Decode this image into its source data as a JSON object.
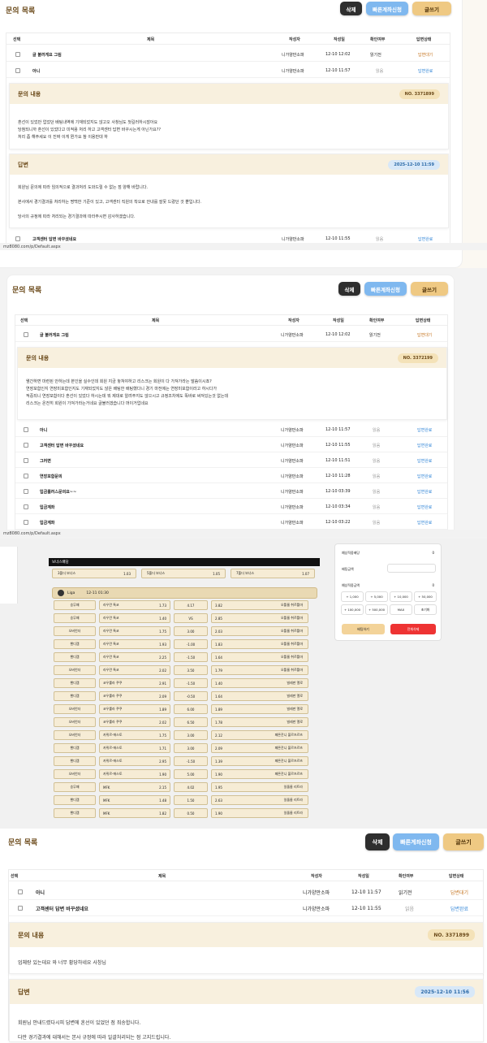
{
  "panel1": {
    "title": "문의 목록",
    "buttons": {
      "delete": "삭제",
      "fast": "빠른계좌신청",
      "write": "글쓰기"
    },
    "headers": [
      "선택",
      "제목",
      "작성자",
      "작성일",
      "확인여부",
      "답변상태"
    ],
    "rows": [
      {
        "title": "글 불러게요 그림",
        "author": "니가양만소파",
        "date": "12-10 12:02",
        "read": "읽기전",
        "status": "답변대기"
      },
      {
        "title": "아니",
        "author": "니가양만소파",
        "date": "12-10 11:57",
        "read": "읽음",
        "status": "답변완료"
      }
    ],
    "inquiry": {
      "label": "문의 내용",
      "no": "NO. 3371899",
      "lines": [
        "혼선이 있었만 업었던 배팅내역에 기재되었지도 않고오 사창님도 첫길러하시잖아요",
        "당첨되니까 혼선이 있었다고 미적용 처리 하고 고객센터 답변 바꾸시는게 아닌가요??",
        "처리 좀 해주세요 이 진짜 이게 뭔가요 참 이용만대 하"
      ]
    },
    "answer": {
      "label": "답변",
      "date": "2025-12-10 11:59",
      "lines": [
        "회원님 문의에 따라 임의적으로 결과처리 도와드릴 수 없는 점 양해 바랍니다.",
        "본사에서 경기결과를 처리하는 명백한 기준이 있고, 고객센터 직원의 착오로 안내를 잘못 드렸던 것 뿐입니다.",
        "당사의 규정에 따라 처리되는 경기결과에 따라주시면 감사하겠습니다."
      ]
    },
    "extra_row": {
      "title": "고객센터 답변 바꾸셨네요",
      "author": "니가양만소파",
      "date": "12-10 11:55",
      "read": "읽음",
      "status": "답변완료"
    },
    "url": "mz8080.com/p/Default.aspx"
  },
  "panel2": {
    "title": "문의 목록",
    "buttons": {
      "delete": "삭제",
      "fast": "빠른계좌신청",
      "write": "글쓰기"
    },
    "headers": [
      "선택",
      "제목",
      "작성자",
      "작성일",
      "확인여부",
      "답변상태"
    ],
    "first_row": {
      "title": "글 불러게요 그림",
      "author": "니가양만소파",
      "date": "12-10 12:02",
      "read": "읽기전",
      "status": "답변대기"
    },
    "inquiry": {
      "label": "문의 내용",
      "no": "NO. 3372199",
      "lines": [
        "웬간하면 마련된 안하는데 본인을 실수인데 회원 지금 놓쳐야하고 리스크는 회원이 다 가져가라는 말씀이시죠?",
        "연장포함인지 연장미포함인지도 기재되었지도 않은 배팅한 배팅했다니 경기 마전에는 연장미포함이라고 하시다가",
        "적중되니 연장포함이다 혼선이 있었다 하시는데 뭐 제대로 알려주지도 않으시고 규정조차에도 똑바로 써져있는것 없는데",
        "리스크는 온전히 회원이 가져가라는거네요 글불러겠습니다 머이거업네요"
      ]
    },
    "rows": [
      {
        "title": "아니",
        "author": "니가양만소파",
        "date": "12-10 11:57",
        "read": "읽음",
        "status": "답변완료"
      },
      {
        "title": "고객센터 답변 바꾸셨네요",
        "author": "니가양만소파",
        "date": "12-10 11:55",
        "read": "읽음",
        "status": "답변완료"
      },
      {
        "title": "그러면",
        "author": "니가양만소파",
        "date": "12-10 11:51",
        "read": "읽음",
        "status": "답변완료"
      },
      {
        "title": "연장포함문의",
        "author": "니가양만소파",
        "date": "12-10 11:28",
        "read": "읽음",
        "status": "답변완료"
      },
      {
        "title": "입금롤러스문의요~~",
        "author": "니가양만소파",
        "date": "12-10 03:39",
        "read": "읽음",
        "status": "답변완료"
      },
      {
        "title": "입금계좌",
        "author": "니가양만소파",
        "date": "12-10 03:34",
        "read": "읽음",
        "status": "답변완료"
      },
      {
        "title": "입금계좌",
        "author": "니가양만소파",
        "date": "12-10 03:22",
        "read": "읽음",
        "status": "답변완료"
      }
    ],
    "url": "mz8080.com/p/Default.aspx"
  },
  "panel3": {
    "bonus_label": "보너스배당",
    "bonuses": [
      {
        "label": "3폴더 보너스",
        "value": "1.03"
      },
      {
        "label": "5폴더 보너스",
        "value": "1.05"
      },
      {
        "label": "7폴더 보너스",
        "value": "1.07"
      }
    ],
    "league": "Liga",
    "kickoff": "12-11 01:30",
    "games": [
      {
        "type": "승무패",
        "home": "라우란 톡코",
        "h": "1.73",
        "d": "4.17",
        "a": "3.82",
        "away": "오틀룸 취르틀마"
      },
      {
        "type": "승무패",
        "home": "라우란 톡코",
        "h": "1.40",
        "d": "VS",
        "a": "2.85",
        "away": "오틀룸 취르틀마"
      },
      {
        "type": "오버언더",
        "home": "라우란 톡코",
        "h": "1.75",
        "d": "3.00",
        "a": "2.03",
        "away": "오틀룸 취르틀마"
      },
      {
        "type": "핸디캡",
        "home": "라우란 톡코",
        "h": "1.93",
        "d": "-1.00",
        "a": "1.83",
        "away": "오틀룸 취르틀마"
      },
      {
        "type": "핸디캡",
        "home": "라우란 톡코",
        "h": "2.25",
        "d": "-1.50",
        "a": "1.64",
        "away": "오틀룸 취르틀마"
      },
      {
        "type": "오버언더",
        "home": "라우란 톡코",
        "h": "2.02",
        "d": "3.50",
        "a": "1.79",
        "away": "오틀룸 취르틀마"
      },
      {
        "type": "핸디캡",
        "home": "코우룰라 쿠쿠",
        "h": "2.91",
        "d": "-1.50",
        "a": "1.40",
        "away": "빌레판 엘로"
      },
      {
        "type": "핸디캡",
        "home": "코우룰라 쿠쿠",
        "h": "2.09",
        "d": "-0.50",
        "a": "1.64",
        "away": "빌레판 엘로"
      },
      {
        "type": "오버언더",
        "home": "코우룰라 쿠쿠",
        "h": "1.89",
        "d": "6.00",
        "a": "1.89",
        "away": "빌레판 엘로"
      },
      {
        "type": "오버언더",
        "home": "코우룰라 쿠쿠",
        "h": "2.02",
        "d": "6.50",
        "a": "1.78",
        "away": "빌레판 엘로"
      },
      {
        "type": "오버언더",
        "home": "카뮈르-에스토",
        "h": "1.75",
        "d": "3.00",
        "a": "2.12",
        "away": "페른잔니 불르츠르츠"
      },
      {
        "type": "핸디캡",
        "home": "카뮈르-에스토",
        "h": "1.71",
        "d": "3.00",
        "a": "2.09",
        "away": "페른잔니 불르츠르츠"
      },
      {
        "type": "핸디캡",
        "home": "카뮈르-에스토",
        "h": "2.95",
        "d": "-1.50",
        "a": "1.39",
        "away": "페른잔니 불르츠르츠"
      },
      {
        "type": "오버언더",
        "home": "카뮈르-에스토",
        "h": "1.90",
        "d": "5.00",
        "a": "1.90",
        "away": "페른잔니 불르츠르츠"
      },
      {
        "type": "승무패",
        "home": "MFK",
        "h": "2.15",
        "d": "4.02",
        "a": "1.95",
        "away": "일돌롬 리트라"
      },
      {
        "type": "핸디캡",
        "home": "MFK",
        "h": "1.48",
        "d": "1.50",
        "a": "2.63",
        "away": "일돌롬 리트라"
      },
      {
        "type": "핸디캡",
        "home": "MFK",
        "h": "1.82",
        "d": "0.50",
        "a": "1.90",
        "away": "일돌롬 리트라"
      }
    ],
    "slip": {
      "rows": [
        "예상적중배당",
        "배팅금액",
        "예상적중금액"
      ],
      "zeros": [
        "0",
        "0",
        "0"
      ],
      "amounts": [
        "+ 1,000",
        "+ 5,000",
        "+ 10,000",
        "+ 50,000",
        "+ 100,000",
        "+ 500,000",
        "MAX",
        "초기화"
      ],
      "bet_btn": "배팅하기",
      "clear_btn": "전체삭제"
    }
  },
  "panel4": {
    "title": "문의 목록",
    "buttons": {
      "delete": "삭제",
      "fast": "빠른계좌신청",
      "write": "글쓰기"
    },
    "headers": [
      "선택",
      "제목",
      "작성자",
      "작성일",
      "확인여부",
      "답변상태"
    ],
    "rows": [
      {
        "title": "아니",
        "author": "니가양만소파",
        "date": "12-10 11:57",
        "read": "읽기전",
        "status": "답변대기"
      },
      {
        "title": "고객센터 답변 바꾸셨네요",
        "author": "니가양만소파",
        "date": "12-10 11:55",
        "read": "읽음",
        "status": "답변완료"
      }
    ],
    "inquiry": {
      "label": "문의 내용",
      "no": "NO. 3371899",
      "lines": [
        "업체랑 있는데요 와 너무 황당하네요 사창님"
      ]
    },
    "answer": {
      "label": "답변",
      "date": "2025-12-10 11:56",
      "lines": [
        "회원님 안내드렸다시피 답변에 혼선이 있었던 점 죄송합니다.",
        "다만 경기결과에 대해서는 본사 규정에 따라 일괄처리되는 점 고지드립니다."
      ]
    }
  }
}
